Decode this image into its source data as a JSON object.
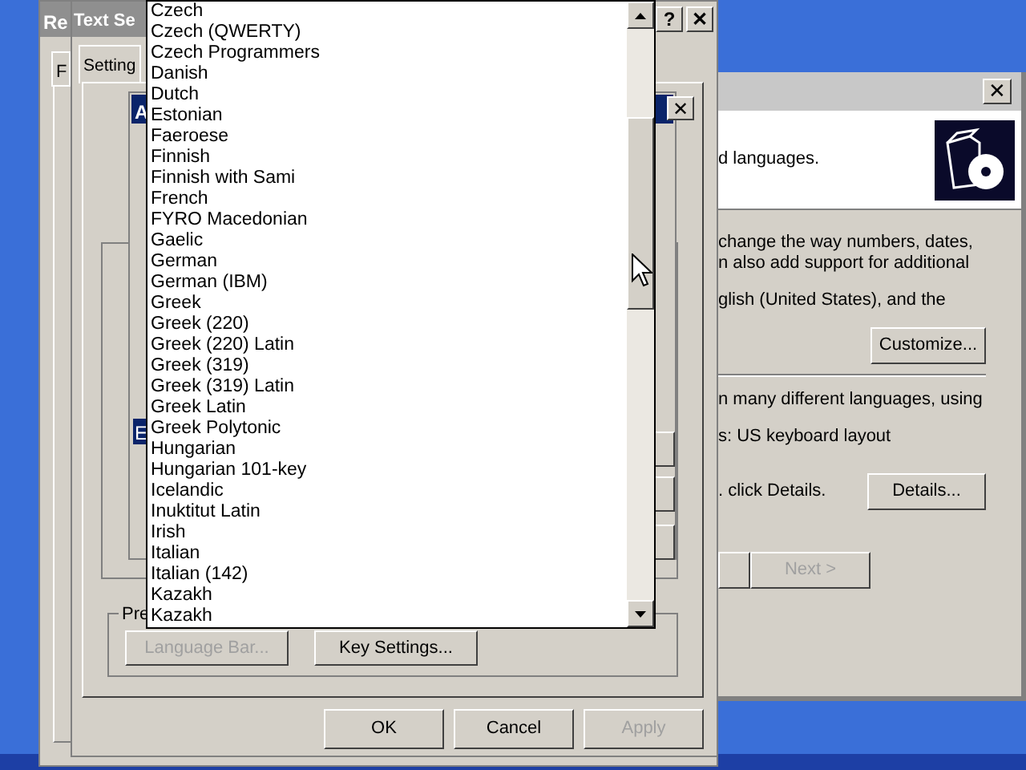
{
  "regional_window": {
    "title": "Re",
    "tab": "F"
  },
  "wizard_window": {
    "header_text": "d languages.",
    "paragraphs": [
      {
        "kind": "text",
        "lines": [
          "change the way numbers, dates,",
          "n also add support for additional"
        ]
      },
      {
        "kind": "text",
        "lines": [
          "glish (United States), and the"
        ]
      },
      {
        "kind": "button",
        "label": "Customize..."
      },
      {
        "kind": "rule"
      },
      {
        "kind": "text",
        "lines": [
          "n many different languages, using"
        ]
      },
      {
        "kind": "text",
        "lines": [
          "s: US keyboard layout"
        ]
      },
      {
        "kind": "text_button",
        "lines": [
          ". click Details."
        ],
        "label": "Details..."
      }
    ],
    "close_button": "✕",
    "next_button": {
      "label": "Next >",
      "disabled": true
    }
  },
  "text_services": {
    "title": "Text Se",
    "title_buttons": [
      "?",
      "✕"
    ],
    "tabs": [
      {
        "label": "Setting",
        "selected": true
      }
    ],
    "group_label": "Pre",
    "group_buttons": [
      {
        "label": "Language Bar...",
        "disabled": true
      },
      {
        "label": "Key Settings...",
        "disabled": false
      }
    ],
    "dialog_buttons": [
      {
        "label": "OK",
        "disabled": false
      },
      {
        "label": "Cancel",
        "disabled": false
      },
      {
        "label": "Apply",
        "disabled": true
      }
    ]
  },
  "add_dialog": {
    "title": "A",
    "close_button": "✕",
    "selected_item": "E"
  },
  "dropdown": {
    "items": [
      "Czech",
      "Czech (QWERTY)",
      "Czech Programmers",
      "Danish",
      "Dutch",
      "Estonian",
      "Faeroese",
      "Finnish",
      "Finnish with Sami",
      "French",
      "FYRO Macedonian",
      "Gaelic",
      "German",
      "German (IBM)",
      "Greek",
      "Greek (220)",
      "Greek (220) Latin",
      "Greek (319)",
      "Greek (319) Latin",
      "Greek Latin",
      "Greek Polytonic",
      "Hungarian",
      "Hungarian 101-key",
      "Icelandic",
      "Inuktitut Latin",
      "Irish",
      "Italian",
      "Italian (142)",
      "Kazakh",
      "Kazakh"
    ]
  }
}
